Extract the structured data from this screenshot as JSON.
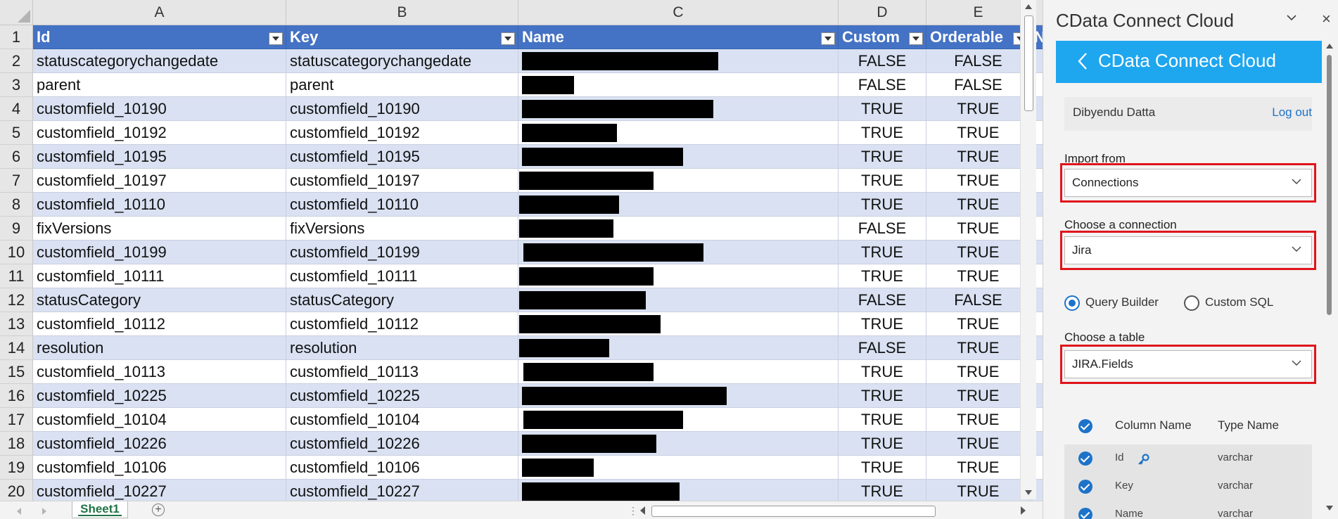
{
  "sheet": {
    "columns": [
      "A",
      "B",
      "C",
      "D",
      "E"
    ],
    "headers": [
      "Id",
      "Key",
      "Name",
      "Custom",
      "Orderable",
      "Na"
    ],
    "rows": [
      {
        "num": "1"
      },
      {
        "num": "2",
        "id": "statuscategorychangedate",
        "key": "statuscategorychangedate",
        "custom": "FALSE",
        "orderable": "FALSE"
      },
      {
        "num": "3",
        "id": "parent",
        "key": "parent",
        "custom": "FALSE",
        "orderable": "FALSE"
      },
      {
        "num": "4",
        "id": "customfield_10190",
        "key": "customfield_10190",
        "custom": "TRUE",
        "orderable": "TRUE"
      },
      {
        "num": "5",
        "id": "customfield_10192",
        "key": "customfield_10192",
        "custom": "TRUE",
        "orderable": "TRUE"
      },
      {
        "num": "6",
        "id": "customfield_10195",
        "key": "customfield_10195",
        "custom": "TRUE",
        "orderable": "TRUE"
      },
      {
        "num": "7",
        "id": "customfield_10197",
        "key": "customfield_10197",
        "custom": "TRUE",
        "orderable": "TRUE"
      },
      {
        "num": "8",
        "id": "customfield_10110",
        "key": "customfield_10110",
        "custom": "TRUE",
        "orderable": "TRUE"
      },
      {
        "num": "9",
        "id": "fixVersions",
        "key": "fixVersions",
        "custom": "FALSE",
        "orderable": "TRUE"
      },
      {
        "num": "10",
        "id": "customfield_10199",
        "key": "customfield_10199",
        "custom": "TRUE",
        "orderable": "TRUE"
      },
      {
        "num": "11",
        "id": "customfield_10111",
        "key": "customfield_10111",
        "custom": "TRUE",
        "orderable": "TRUE"
      },
      {
        "num": "12",
        "id": "statusCategory",
        "key": "statusCategory",
        "custom": "FALSE",
        "orderable": "FALSE"
      },
      {
        "num": "13",
        "id": "customfield_10112",
        "key": "customfield_10112",
        "custom": "TRUE",
        "orderable": "TRUE"
      },
      {
        "num": "14",
        "id": "resolution",
        "key": "resolution",
        "custom": "FALSE",
        "orderable": "TRUE"
      },
      {
        "num": "15",
        "id": "customfield_10113",
        "key": "customfield_10113",
        "custom": "TRUE",
        "orderable": "TRUE"
      },
      {
        "num": "16",
        "id": "customfield_10225",
        "key": "customfield_10225",
        "custom": "TRUE",
        "orderable": "TRUE"
      },
      {
        "num": "17",
        "id": "customfield_10104",
        "key": "customfield_10104",
        "custom": "TRUE",
        "orderable": "TRUE"
      },
      {
        "num": "18",
        "id": "customfield_10226",
        "key": "customfield_10226",
        "custom": "TRUE",
        "orderable": "TRUE"
      },
      {
        "num": "19",
        "id": "customfield_10106",
        "key": "customfield_10106",
        "custom": "TRUE",
        "orderable": "TRUE"
      },
      {
        "num": "20",
        "id": "customfield_10227",
        "key": "customfield_10227",
        "custom": "TRUE",
        "orderable": "TRUE"
      }
    ],
    "sheet_tab": "Sheet1",
    "add_sheet": "+",
    "hscroll_dots": "⋮"
  },
  "pane": {
    "title": "CData Connect Cloud",
    "close": "×",
    "brand": "CData Connect Cloud",
    "user": "Dibyendu Datta",
    "logout": "Log out",
    "import_label": "Import from",
    "import_value": "Connections",
    "connection_label": "Choose a connection",
    "connection_value": "Jira",
    "radio_query": "Query Builder",
    "radio_sql": "Custom SQL",
    "table_label": "Choose a table",
    "table_value": "JIRA.Fields",
    "col_header_name": "Column Name",
    "col_header_type": "Type Name",
    "columns": [
      {
        "name": "Id",
        "type": "varchar"
      },
      {
        "name": "Key",
        "type": "varchar"
      },
      {
        "name": "Name",
        "type": "varchar"
      }
    ]
  },
  "colors": {
    "table_header": "#4472c4",
    "band": "#d9e1f2",
    "brand": "#1ea6ef",
    "accent": "#1d73c9",
    "highlight": "#e0141c",
    "sheet_tab": "#217346"
  }
}
